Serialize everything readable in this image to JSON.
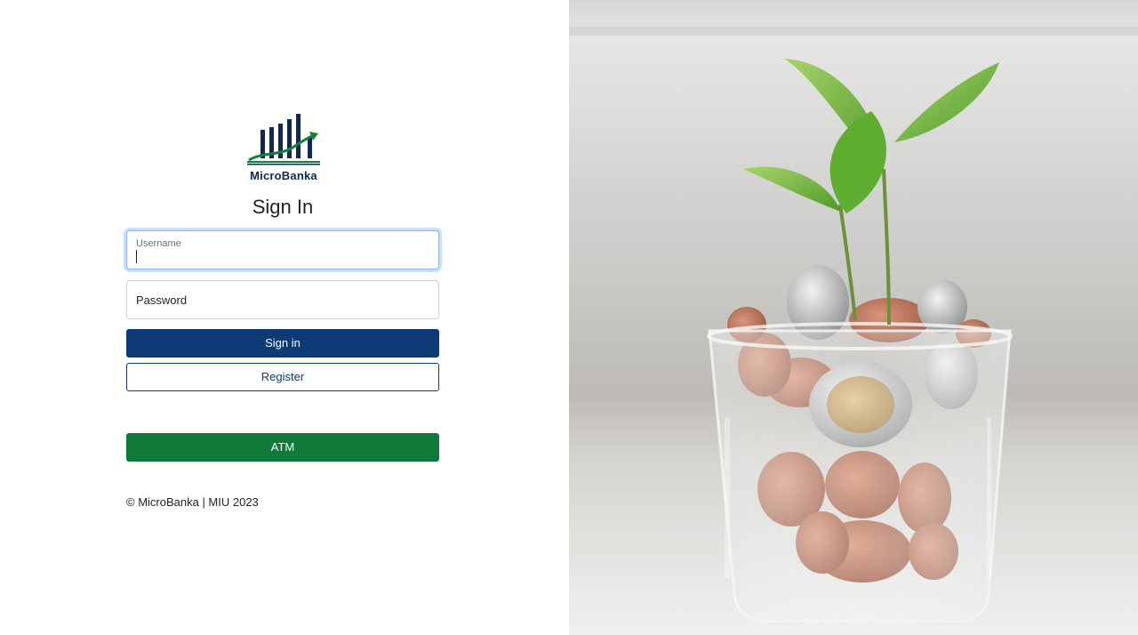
{
  "brand": {
    "name": "MicroBanka",
    "colors": {
      "navy": "#0d2a57",
      "green": "#16803a",
      "primary_button": "#0d3b75",
      "atm_button": "#0f7a3a"
    }
  },
  "form": {
    "title": "Sign In",
    "username": {
      "label": "Username",
      "value": ""
    },
    "password": {
      "placeholder": "Password"
    },
    "sign_in_label": "Sign in",
    "register_label": "Register",
    "atm_label": "ATM"
  },
  "footer": {
    "text": "© MicroBanka | MIU 2023"
  },
  "hero": {
    "icon": "plant-in-glass-of-coins-photo"
  }
}
